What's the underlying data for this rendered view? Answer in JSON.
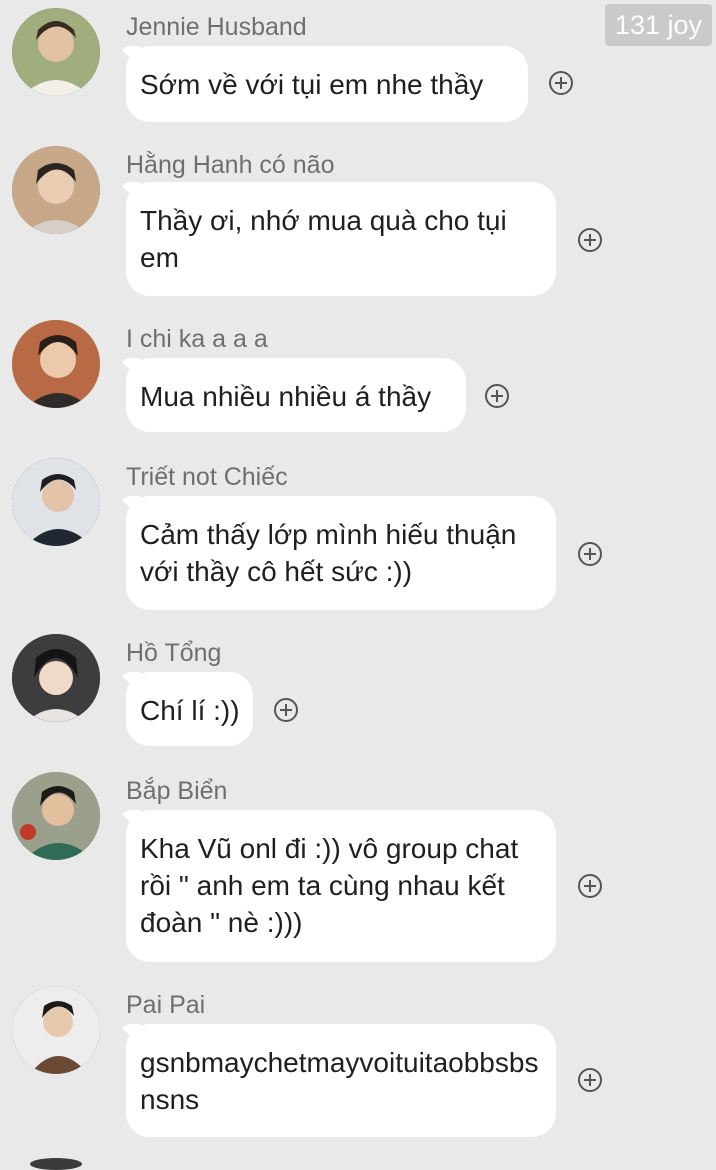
{
  "watermark": "131 joy",
  "messages": [
    {
      "sender": "Jennie Husband",
      "text": "Sớm về với tụi em nhe thầy",
      "avatar_color": "#6b7a4a"
    },
    {
      "sender": "Hằng Hanh có não",
      "text": "Thầy ơi, nhớ mua quà cho tụi em",
      "avatar_color": "#8a6a52"
    },
    {
      "sender": "I chi ka a a a",
      "text": "Mua nhiều nhiều á thầy",
      "avatar_color": "#b0623e"
    },
    {
      "sender": "Triết not Chiếc",
      "text": "Cảm thấy lớp mình hiếu thuận với thầy cô hết sức :))",
      "avatar_color": "#2b3340"
    },
    {
      "sender": "Hồ Tổng",
      "text": "Chí lí :))",
      "avatar_color": "#3b3b3b"
    },
    {
      "sender": "Bắp Biển",
      "text": "Kha Vũ onl đi :)) vô group chat rồi \"  anh em ta cùng nhau kết đoàn \"  nè :)))",
      "avatar_color": "#3a6b4c"
    },
    {
      "sender": "Pai Pai",
      "text": "gsnbmaychetmayvoituitaobbsbsnsns",
      "avatar_color": "#5a4636"
    }
  ],
  "icons": {
    "react": "add-circle-icon",
    "avatar": "avatar-photo"
  },
  "colors": {
    "background": "#e9e9e9",
    "bubble": "#ffffff",
    "sender_name": "#6f6f6f",
    "message_text": "#1f1f1f"
  }
}
